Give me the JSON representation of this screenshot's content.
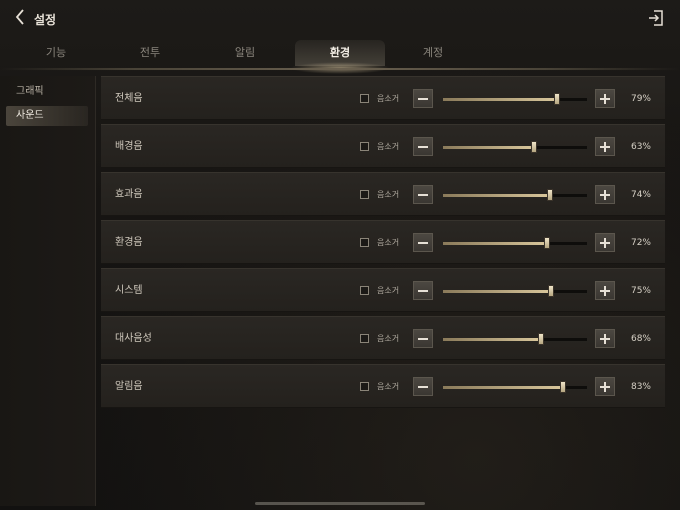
{
  "header": {
    "title": "설정",
    "back_icon": "chevron-left-icon",
    "exit_icon": "exit-icon"
  },
  "tabs": [
    {
      "label": "기능",
      "active": false
    },
    {
      "label": "전투",
      "active": false
    },
    {
      "label": "알림",
      "active": false
    },
    {
      "label": "환경",
      "active": true
    },
    {
      "label": "계정",
      "active": false
    }
  ],
  "sidebar": {
    "items": [
      {
        "label": "그래픽",
        "active": false
      },
      {
        "label": "사운드",
        "active": true
      }
    ]
  },
  "sound": {
    "mute_label": "음소거",
    "rows": [
      {
        "label": "전체음",
        "value": 79,
        "value_text": "79%",
        "muted": false
      },
      {
        "label": "배경음",
        "value": 63,
        "value_text": "63%",
        "muted": false
      },
      {
        "label": "효과음",
        "value": 74,
        "value_text": "74%",
        "muted": false
      },
      {
        "label": "환경음",
        "value": 72,
        "value_text": "72%",
        "muted": false
      },
      {
        "label": "시스템",
        "value": 75,
        "value_text": "75%",
        "muted": false
      },
      {
        "label": "대사음성",
        "value": 68,
        "value_text": "68%",
        "muted": false
      },
      {
        "label": "알림음",
        "value": 83,
        "value_text": "83%",
        "muted": false
      }
    ]
  },
  "colors": {
    "accent": "#d9c79c",
    "background": "#141210",
    "panel": "#2a2723"
  }
}
